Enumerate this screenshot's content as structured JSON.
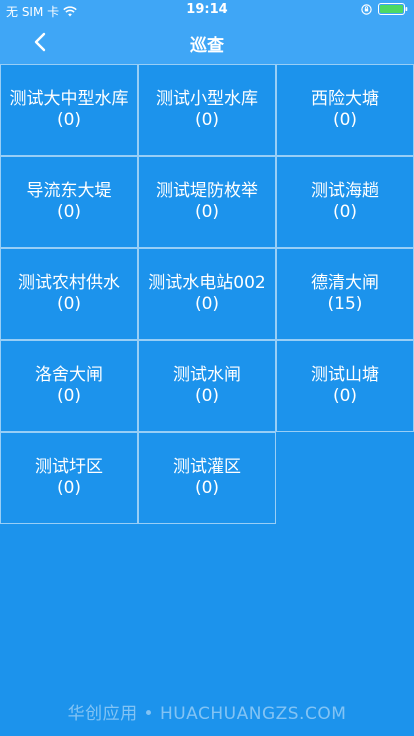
{
  "status_bar": {
    "carrier": "无 SIM 卡",
    "time": "19:14"
  },
  "nav": {
    "title": "巡查"
  },
  "tiles": [
    {
      "name": "测试大中型水库",
      "count": "(0)"
    },
    {
      "name": "测试小型水库",
      "count": "(0)"
    },
    {
      "name": "西险大塘",
      "count": "(0)"
    },
    {
      "name": "导流东大堤",
      "count": "(0)"
    },
    {
      "name": "测试堤防枚举",
      "count": "(0)"
    },
    {
      "name": "测试海趟",
      "count": "(0)"
    },
    {
      "name": "测试农村供水",
      "count": "(0)"
    },
    {
      "name": "测试水电站002",
      "count": "(0)"
    },
    {
      "name": "德清大闸",
      "count": "(15)"
    },
    {
      "name": "洛舍大闸",
      "count": "(0)"
    },
    {
      "name": "测试水闸",
      "count": "(0)"
    },
    {
      "name": "测试山塘",
      "count": "(0)"
    },
    {
      "name": "测试圩区",
      "count": "(0)"
    },
    {
      "name": "测试灌区",
      "count": "(0)"
    }
  ],
  "watermark": "华创应用 • HUACHUANGZS.COM"
}
